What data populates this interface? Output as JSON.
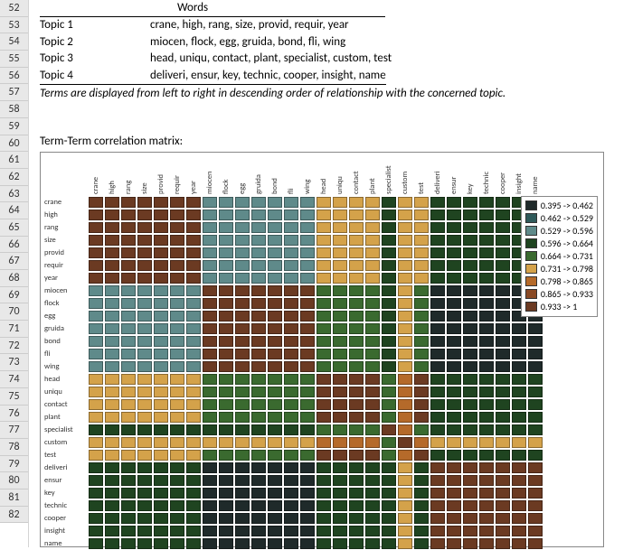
{
  "rows_start": 52,
  "rows_end": 82,
  "topics_header": "Words",
  "topics": [
    {
      "label": "Topic 1",
      "words": "crane, high, rang, size, provid, requir, year"
    },
    {
      "label": "Topic 2",
      "words": "miocen, flock, egg, gruida, bond, fli, wing"
    },
    {
      "label": "Topic 3",
      "words": "head, uniqu, contact, plant, specialist, custom, test"
    },
    {
      "label": "Topic 4",
      "words": "deliveri, ensur, key, technic, cooper, insight, name"
    }
  ],
  "caption": "Terms are displayed from left to right in descending order of relationship with the concerned topic.",
  "matrix_title": "Term-Term correlation matrix:",
  "terms": [
    "crane",
    "high",
    "rang",
    "size",
    "provid",
    "requir",
    "year",
    "miocen",
    "flock",
    "egg",
    "gruida",
    "bond",
    "fli",
    "wing",
    "head",
    "uniqu",
    "contact",
    "plant",
    "specialist",
    "custom",
    "test",
    "deliveri",
    "ensur",
    "key",
    "technic",
    "cooper",
    "insight",
    "name"
  ],
  "legend": [
    {
      "color": "#1f2a2a",
      "label": "0.395 -> 0.462"
    },
    {
      "color": "#2f5a5a",
      "label": "0.462 -> 0.529"
    },
    {
      "color": "#5f8a8a",
      "label": "0.529 -> 0.596"
    },
    {
      "color": "#1f4420",
      "label": "0.596 -> 0.664"
    },
    {
      "color": "#3a6a2f",
      "label": "0.664 -> 0.731"
    },
    {
      "color": "#d4a24a",
      "label": "0.731 -> 0.798"
    },
    {
      "color": "#b56a2a",
      "label": "0.798 -> 0.865"
    },
    {
      "color": "#8a4a25",
      "label": "0.865 -> 0.933"
    },
    {
      "color": "#6b3a22",
      "label": "0.933 -> 1"
    }
  ],
  "chart_data": {
    "type": "heatmap",
    "title": "Term-Term correlation matrix",
    "xlabel": "",
    "ylabel": "",
    "categories": [
      "crane",
      "high",
      "rang",
      "size",
      "provid",
      "requir",
      "year",
      "miocen",
      "flock",
      "egg",
      "gruida",
      "bond",
      "fli",
      "wing",
      "head",
      "uniqu",
      "contact",
      "plant",
      "specialist",
      "custom",
      "test",
      "deliveri",
      "ensur",
      "key",
      "technic",
      "cooper",
      "insight",
      "name"
    ],
    "bins": [
      {
        "min": 0.395,
        "max": 0.462,
        "color": "#1f2a2a"
      },
      {
        "min": 0.462,
        "max": 0.529,
        "color": "#2f5a5a"
      },
      {
        "min": 0.529,
        "max": 0.596,
        "color": "#5f8a8a"
      },
      {
        "min": 0.596,
        "max": 0.664,
        "color": "#1f4420"
      },
      {
        "min": 0.664,
        "max": 0.731,
        "color": "#3a6a2f"
      },
      {
        "min": 0.731,
        "max": 0.798,
        "color": "#d4a24a"
      },
      {
        "min": 0.798,
        "max": 0.865,
        "color": "#b56a2a"
      },
      {
        "min": 0.865,
        "max": 0.933,
        "color": "#8a4a25"
      },
      {
        "min": 0.933,
        "max": 1.0,
        "color": "#6b3a22"
      }
    ],
    "group_map": [
      0,
      0,
      0,
      0,
      0,
      0,
      0,
      1,
      1,
      1,
      1,
      1,
      1,
      1,
      2,
      2,
      2,
      2,
      2,
      2,
      2,
      3,
      3,
      3,
      3,
      3,
      3,
      3
    ],
    "cross_bins": [
      [
        8,
        2,
        5,
        3
      ],
      [
        2,
        8,
        4,
        0
      ],
      [
        5,
        4,
        8,
        3
      ],
      [
        3,
        0,
        3,
        8
      ]
    ],
    "special_columns": {
      "18": {
        "default_bin": 3,
        "same_group_bin": 4
      },
      "19": {
        "default_bin": 5,
        "same_group_bin": 6
      }
    }
  }
}
